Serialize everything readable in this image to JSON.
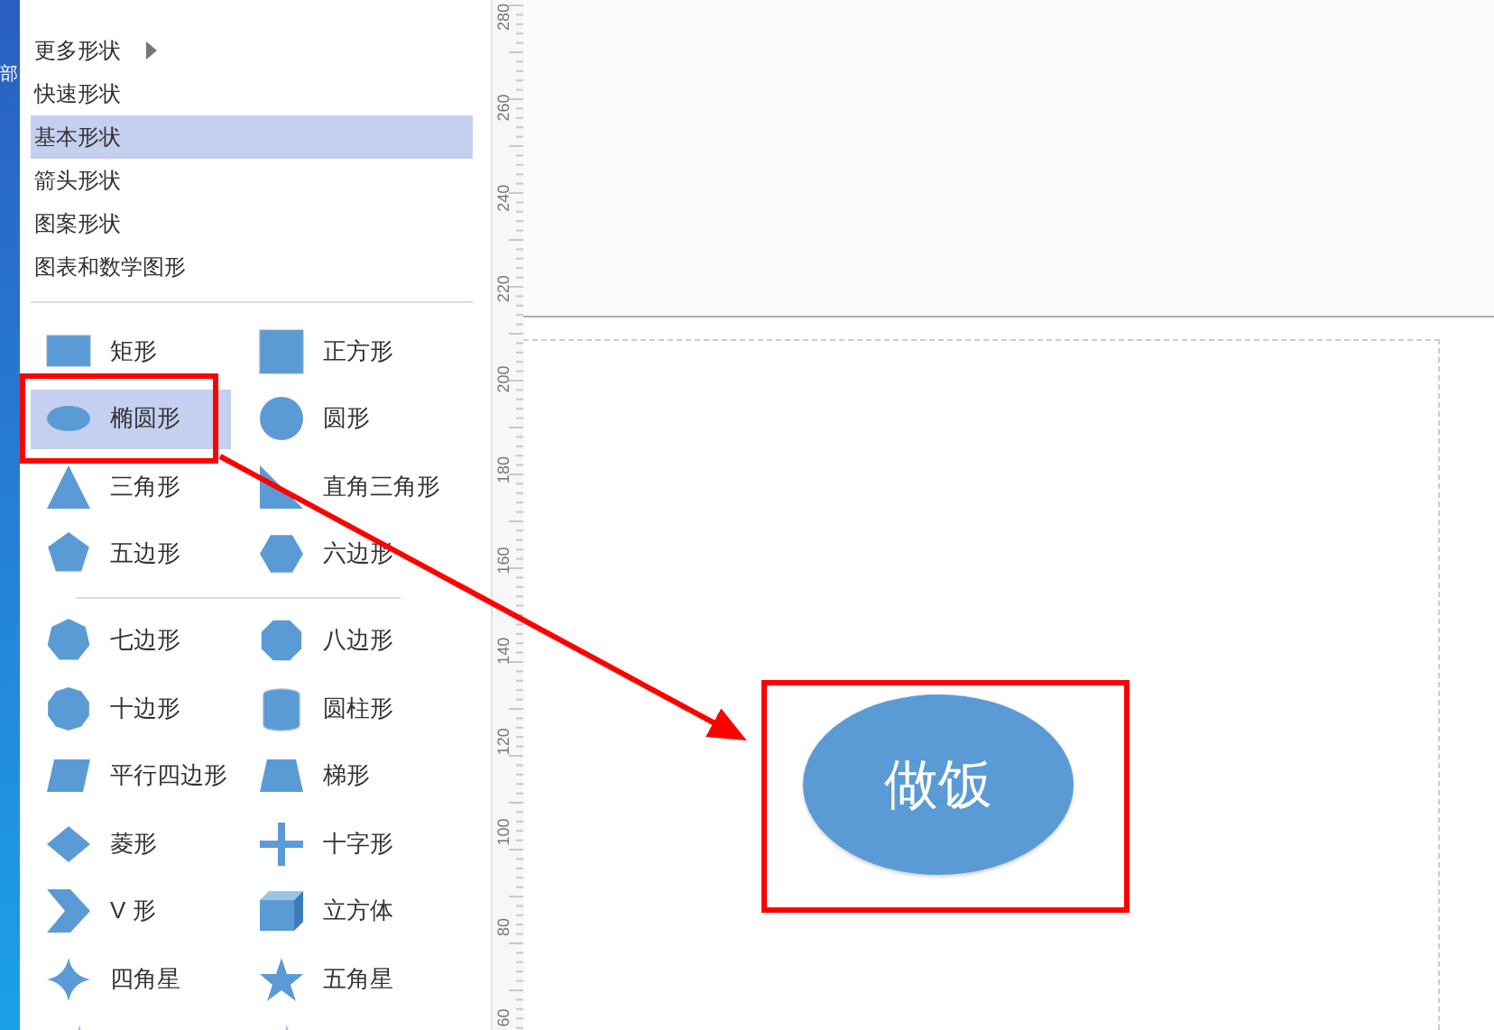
{
  "desktop_fragment": "部",
  "menu": [
    {
      "label": "更多形状",
      "has_submenu": true,
      "selected": false
    },
    {
      "label": "快速形状",
      "has_submenu": false,
      "selected": false
    },
    {
      "label": "基本形状",
      "has_submenu": false,
      "selected": true
    },
    {
      "label": "箭头形状",
      "has_submenu": false,
      "selected": false
    },
    {
      "label": "图案形状",
      "has_submenu": false,
      "selected": false
    },
    {
      "label": "图表和数学图形",
      "has_submenu": false,
      "selected": false
    }
  ],
  "shape_groups": [
    [
      {
        "label": "矩形",
        "kind": "rectangle",
        "selected": false
      },
      {
        "label": "正方形",
        "kind": "square",
        "selected": false
      },
      {
        "label": "椭圆形",
        "kind": "ellipse",
        "selected": true
      },
      {
        "label": "圆形",
        "kind": "circle",
        "selected": false
      },
      {
        "label": "三角形",
        "kind": "triangle",
        "selected": false
      },
      {
        "label": "直角三角形",
        "kind": "right-triangle",
        "selected": false
      },
      {
        "label": "五边形",
        "kind": "pentagon",
        "selected": false
      },
      {
        "label": "六边形",
        "kind": "hexagon",
        "selected": false
      }
    ],
    [
      {
        "label": "七边形",
        "kind": "heptagon",
        "selected": false
      },
      {
        "label": "八边形",
        "kind": "octagon",
        "selected": false
      },
      {
        "label": "十边形",
        "kind": "decagon",
        "selected": false
      },
      {
        "label": "圆柱形",
        "kind": "cylinder",
        "selected": false
      },
      {
        "label": "平行四边形",
        "kind": "parallelogram",
        "selected": false
      },
      {
        "label": "梯形",
        "kind": "trapezoid",
        "selected": false
      },
      {
        "label": "菱形",
        "kind": "diamond",
        "selected": false
      },
      {
        "label": "十字形",
        "kind": "cross",
        "selected": false
      },
      {
        "label": "V 形",
        "kind": "chevron",
        "selected": false
      },
      {
        "label": "立方体",
        "kind": "cube",
        "selected": false
      },
      {
        "label": "四角星",
        "kind": "star4",
        "selected": false
      },
      {
        "label": "五角星",
        "kind": "star5",
        "selected": false
      }
    ]
  ],
  "ruler": {
    "labels": [
      "280",
      "260",
      "240",
      "220",
      "200",
      "180",
      "160",
      "140",
      "120",
      "100",
      "80",
      "60"
    ]
  },
  "canvas": {
    "shape_text": "做饭"
  }
}
